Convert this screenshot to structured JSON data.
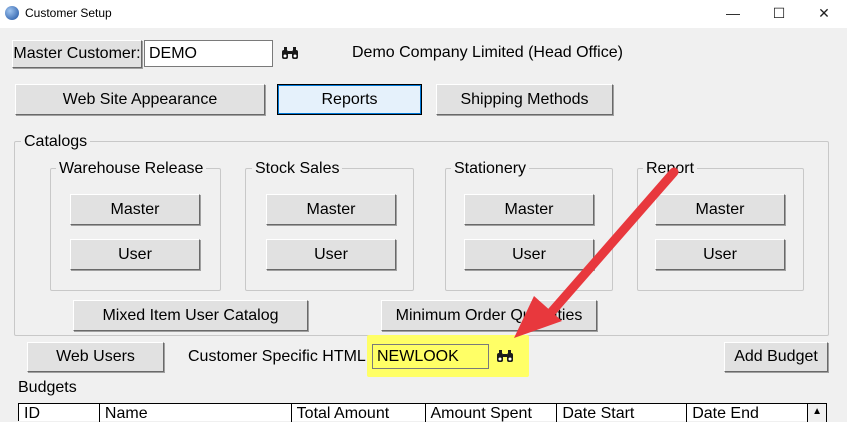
{
  "window": {
    "title": "Customer Setup",
    "minimize_glyph": "—",
    "maximize_glyph": "☐",
    "close_glyph": "✕"
  },
  "master_customer": {
    "button_label": "Master Customer:",
    "value": "DEMO",
    "company_name": "Demo Company Limited (Head Office)"
  },
  "top_buttons": {
    "web_site_appearance": "Web Site Appearance",
    "reports": "Reports",
    "shipping_methods": "Shipping Methods"
  },
  "catalogs": {
    "legend": "Catalogs",
    "groups": [
      {
        "title": "Warehouse Release",
        "master": "Master",
        "user": "User"
      },
      {
        "title": "Stock Sales",
        "master": "Master",
        "user": "User"
      },
      {
        "title": "Stationery",
        "master": "Master",
        "user": "User"
      },
      {
        "title": "Report",
        "master": "Master",
        "user": "User"
      }
    ],
    "mixed_item_user_catalog": "Mixed Item User Catalog",
    "minimum_order_quantities": "Minimum Order Quantities"
  },
  "web_users_button": "Web Users",
  "customer_html": {
    "label": "Customer Specific HTML:",
    "value": "NEWLOOK"
  },
  "add_budget_button": "Add Budget",
  "budgets": {
    "label": "Budgets",
    "columns": [
      "ID",
      "Name",
      "Total Amount",
      "Amount Spent",
      "Date Start",
      "Date End"
    ],
    "scroll_up_glyph": "▲"
  },
  "colors": {
    "highlight": "#ffff66",
    "annotation_arrow": "#e8383d",
    "binoculars": "#1a1a1a"
  },
  "icons": {
    "lookup": "binoculars-icon",
    "app": "app-icon"
  }
}
